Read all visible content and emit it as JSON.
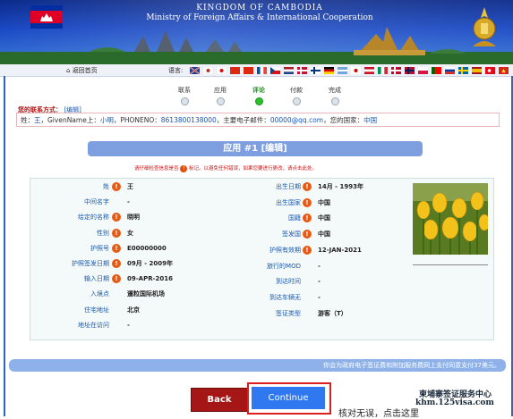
{
  "banner": {
    "line1": "KINGDOM OF CAMBODIA",
    "line2": "Ministry of Foreign Affairs & International Cooperation"
  },
  "nav": {
    "home_label": "返回首页",
    "language_label": "语言:"
  },
  "steps": [
    {
      "label": "联系",
      "active": false
    },
    {
      "label": "应用",
      "active": false
    },
    {
      "label": "评论",
      "active": true
    },
    {
      "label": "付款",
      "active": false
    },
    {
      "label": "完成",
      "active": false
    }
  ],
  "contact": {
    "title": "您的联系方式：",
    "edit": "[编辑]",
    "surname_label": "姓：",
    "surname": "王",
    "given_label": "，GivenName上：",
    "given": "小明",
    "phone_label": "，PHONENO：",
    "phone": "8613800138000",
    "email_label": "，主要电子邮件：",
    "email": "00000@qq.com",
    "country_label": "，您的国家：",
    "country": "中国"
  },
  "application": {
    "header": "应用 #1 [编辑]",
    "notice_pre": "请仔细检查信息是否",
    "notice_mark": "!",
    "notice_post": "标记。以避免任何错误，如果您要进行更改，请点击此处。"
  },
  "fields_left": [
    {
      "label": "姓",
      "value": "王",
      "warn": true
    },
    {
      "label": "中间名字",
      "value": "-",
      "warn": false
    },
    {
      "label": "给定的名称",
      "value": "晓明",
      "warn": true
    },
    {
      "label": "性别",
      "value": "女",
      "warn": true
    },
    {
      "label": "护照号",
      "value": "E00000000",
      "warn": true
    },
    {
      "label": "护照签发日期",
      "value": "09月 - 2009年",
      "warn": true
    },
    {
      "label": "输入日期",
      "value": "09-APR-2016",
      "warn": true
    },
    {
      "label": "入境点",
      "value": "暹粒国际机场",
      "warn": false
    },
    {
      "label": "住宅地址",
      "value": "北京",
      "warn": false
    },
    {
      "label": "地址在访问",
      "value": "-",
      "warn": false
    }
  ],
  "fields_right": [
    {
      "label": "出生日期",
      "value": "14月 - 1993年",
      "warn": true
    },
    {
      "label": "出生国家",
      "value": "中国",
      "warn": true
    },
    {
      "label": "国籍",
      "value": "中国",
      "warn": true
    },
    {
      "label": "签发国",
      "value": "中国",
      "warn": true
    },
    {
      "label": "护照有效期",
      "value": "12-JAN-2021",
      "warn": true
    },
    {
      "label": "旅行的MOD",
      "value": "-",
      "warn": false
    },
    {
      "label": "到达时间",
      "value": "-",
      "warn": false
    },
    {
      "label": "到达车辆无",
      "value": "-",
      "warn": false
    },
    {
      "label": "签证类型",
      "value": "游客（T）",
      "warn": false
    }
  ],
  "footer": {
    "fee_text": "你会为政府电子签证费和附加服务费网上支付同意支付37美元。",
    "back_label": "Back",
    "continue_label": "Continue",
    "confirm_tip": "核对无误，点击这里"
  },
  "watermark": {
    "line1": "柬埔寨签证服务中心",
    "line2": "khm.125visa.com"
  },
  "colors": {
    "primary_blue": "#2f78f0",
    "back_red": "#a51616",
    "warn_orange": "#e85a14",
    "active_green": "#2cc02c"
  }
}
